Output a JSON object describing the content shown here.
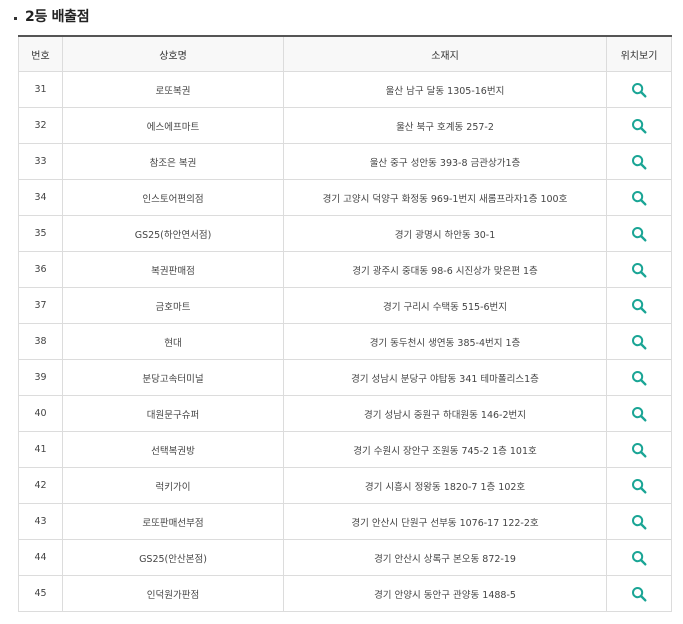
{
  "section": {
    "title": "2등 배출점"
  },
  "table": {
    "headers": {
      "no": "번호",
      "name": "상호명",
      "address": "소재지",
      "map": "위치보기"
    },
    "rows": [
      {
        "no": "31",
        "name": "로또복권",
        "address": "울산 남구 달동 1305-16번지"
      },
      {
        "no": "32",
        "name": "에스에프마트",
        "address": "울산 북구 호계동 257-2"
      },
      {
        "no": "33",
        "name": "참조은 복권",
        "address": "울산 중구 성안동 393-8 금관상가1층"
      },
      {
        "no": "34",
        "name": "인스토어편의점",
        "address": "경기 고양시 덕양구 화정동 969-1번지 새롬프라자1층 100호"
      },
      {
        "no": "35",
        "name": "GS25(하안연서점)",
        "address": "경기 광명시 하안동 30-1"
      },
      {
        "no": "36",
        "name": "복권판매점",
        "address": "경기 광주시 중대동 98-6 시진상가 맞은편 1층"
      },
      {
        "no": "37",
        "name": "금호마트",
        "address": "경기 구리시 수택동 515-6번지"
      },
      {
        "no": "38",
        "name": "현대",
        "address": "경기 동두천시 생연동 385-4번지 1층"
      },
      {
        "no": "39",
        "name": "분당고속터미널",
        "address": "경기 성남시 분당구 야탑동 341 테마폴리스1층"
      },
      {
        "no": "40",
        "name": "대원문구슈퍼",
        "address": "경기 성남시 중원구 하대원동 146-2번지"
      },
      {
        "no": "41",
        "name": "선택복권방",
        "address": "경기 수원시 장안구 조원동 745-2 1층 101호"
      },
      {
        "no": "42",
        "name": "럭키가이",
        "address": "경기 시흥시 정왕동 1820-7 1층 102호"
      },
      {
        "no": "43",
        "name": "로또판매선부점",
        "address": "경기 안산시 단원구 선부동 1076-17 122-2호"
      },
      {
        "no": "44",
        "name": "GS25(안산본점)",
        "address": "경기 안산시 상록구 본오동 872-19"
      },
      {
        "no": "45",
        "name": "인덕원가판점",
        "address": "경기 안양시 동안구 관양동 1488-5"
      }
    ]
  },
  "icons": {
    "map_search": "search-icon"
  },
  "colors": {
    "accent": "#1aa595",
    "header_bg": "#f8f8f8",
    "border": "#dcdcdc",
    "top_border": "#555555"
  }
}
